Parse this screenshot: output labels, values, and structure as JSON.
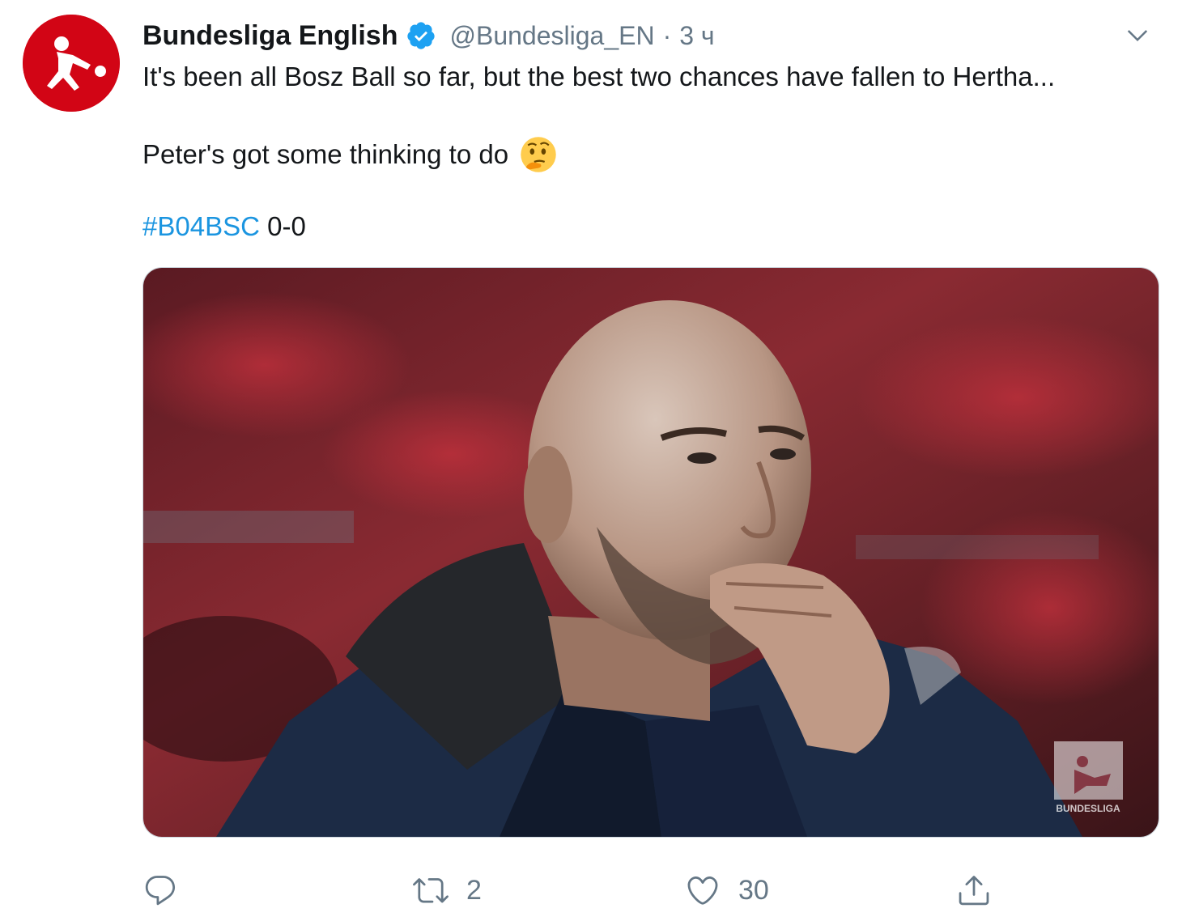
{
  "tweet": {
    "author": {
      "display_name": "Bundesliga English",
      "handle": "@Bundesliga_EN",
      "separator": "·",
      "time": "3 ч",
      "verified": true,
      "avatar_icon": "bundesliga-logo-icon",
      "avatar_color": "#d20515"
    },
    "text": {
      "line1": "It's been all Bosz Ball so far, but the best two chances have fallen to Hertha...",
      "line2": "Peter's got some thinking to do",
      "line2_emoji": "thinking-face-emoji",
      "hashtag": "#B04BSC",
      "score": " 0-0"
    },
    "media": {
      "watermark": "BUNDESLIGA",
      "description_icon": "photo"
    },
    "actions": {
      "reply": {
        "icon": "reply-icon",
        "count": ""
      },
      "retweet": {
        "icon": "retweet-icon",
        "count": "2"
      },
      "like": {
        "icon": "heart-icon",
        "count": "30"
      },
      "share": {
        "icon": "share-icon"
      }
    },
    "colors": {
      "link": "#1b95e0",
      "secondary_text": "#657786",
      "verified": "#1da1f2",
      "text": "#14171a"
    }
  }
}
